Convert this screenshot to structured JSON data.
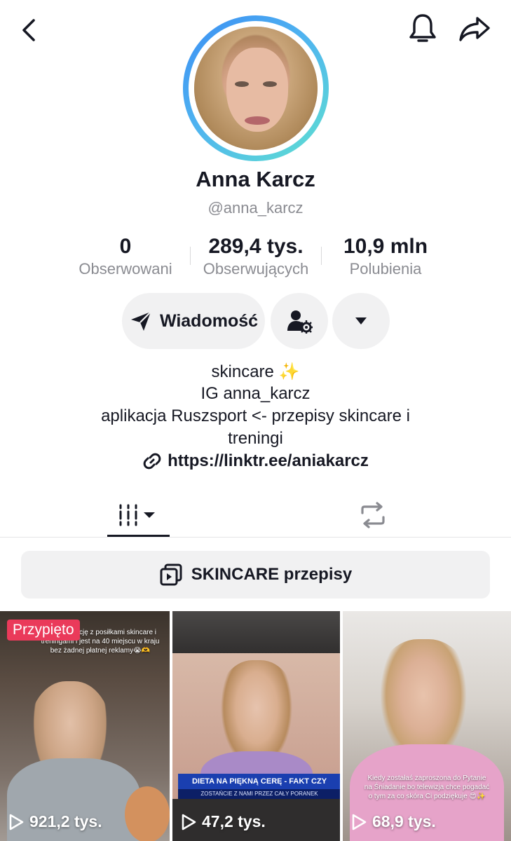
{
  "profile": {
    "name": "Anna Karcz",
    "handle": "@anna_karcz"
  },
  "stats": [
    {
      "value": "0",
      "label": "Obserwowani"
    },
    {
      "value": "289,4 tys.",
      "label": "Obserwujących"
    },
    {
      "value": "10,9 mln",
      "label": "Polubienia"
    }
  ],
  "actions": {
    "message_label": "Wiadomość"
  },
  "bio": {
    "line1": "skincare ✨",
    "line2": "IG anna_karcz",
    "line3": "aplikacja Ruszsport <- przepisy skincare i",
    "line4": "treningi",
    "link": "https://linktr.ee/aniakarcz"
  },
  "playlist": {
    "label": "SKINCARE przepisy"
  },
  "videos": [
    {
      "views": "921,2 tys.",
      "badge": "Przypięto",
      "caption": "...łaś aplikację z posiłkami skincare i treningami i jest na 40 miejscu w kraju bez żadnej płatnej reklamy😭🫶"
    },
    {
      "views": "47,2 tys.",
      "banner": "DIETA NA PIĘKNĄ CERĘ - FAKT CZY INSTAGRAM",
      "banner_sub": "ZOSTAŃCIE Z NAMI PRZEZ CAŁY PORANEK"
    },
    {
      "views": "68,9 tys.",
      "caption": "Kiedy zostałaś zaproszona do Pytanie na Śniadanie bo telewizja chce pogadać o tym za co skóra Ci podziękuje 😍✨"
    }
  ],
  "colors": {
    "pinned_badge": "#ea3a5a",
    "ring_start": "#3b8df3",
    "ring_end": "#5fe0d0"
  }
}
